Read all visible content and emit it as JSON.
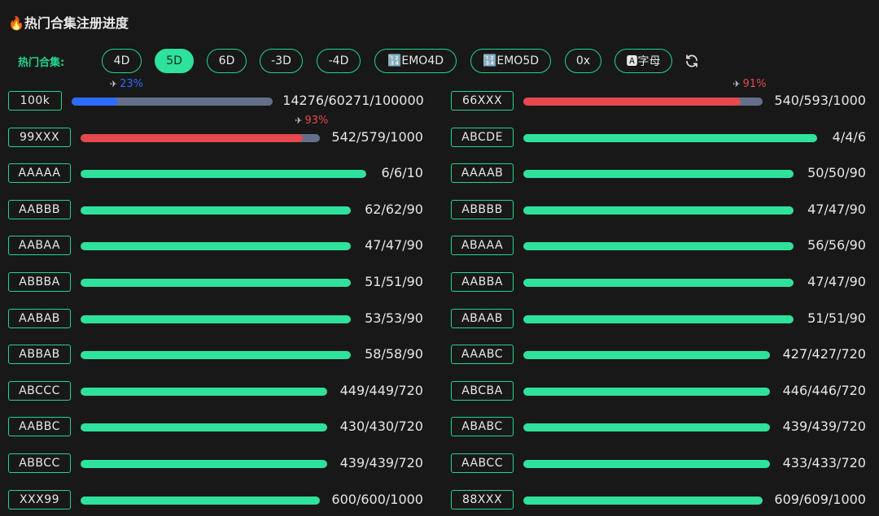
{
  "title": "🔥热门合集注册进度",
  "filter": {
    "label": "热门合集:",
    "chips": [
      {
        "label": "4D",
        "active": false
      },
      {
        "label": "5D",
        "active": true
      },
      {
        "label": "6D",
        "active": false
      },
      {
        "label": "-3D",
        "active": false
      },
      {
        "label": "-4D",
        "active": false
      },
      {
        "label": "🔢EMO4D",
        "active": false
      },
      {
        "label": "🔢EMO5D",
        "active": false
      },
      {
        "label": "0x",
        "active": false
      },
      {
        "label": "🅰字母",
        "active": false
      }
    ],
    "refresh_icon": "refresh-icon"
  },
  "colors": {
    "accent": "#23d58e",
    "fill_green": "#2ee29c",
    "fill_blue": "#2f6bff",
    "fill_red": "#e5484d",
    "track": "#63708a"
  },
  "collections": {
    "left": [
      {
        "tag": "100k",
        "value": "14276/60271/100000",
        "progress": 0.23,
        "percent_label": "23%",
        "color": "blue",
        "plane_icon": "✈"
      },
      {
        "tag": "99XXX",
        "value": "542/579/1000",
        "progress": 0.93,
        "percent_label": "93%",
        "color": "red",
        "plane_icon": "✈"
      },
      {
        "tag": "AAAAA",
        "value": "6/6/10",
        "progress": 1,
        "color": "green"
      },
      {
        "tag": "AABBB",
        "value": "62/62/90",
        "progress": 1,
        "color": "green"
      },
      {
        "tag": "AABAA",
        "value": "47/47/90",
        "progress": 1,
        "color": "green"
      },
      {
        "tag": "ABBBA",
        "value": "51/51/90",
        "progress": 1,
        "color": "green"
      },
      {
        "tag": "AABAB",
        "value": "53/53/90",
        "progress": 1,
        "color": "green"
      },
      {
        "tag": "ABBAB",
        "value": "58/58/90",
        "progress": 1,
        "color": "green"
      },
      {
        "tag": "ABCCC",
        "value": "449/449/720",
        "progress": 1,
        "color": "green"
      },
      {
        "tag": "AABBC",
        "value": "430/430/720",
        "progress": 1,
        "color": "green"
      },
      {
        "tag": "ABBCC",
        "value": "439/439/720",
        "progress": 1,
        "color": "green"
      },
      {
        "tag": "XXX99",
        "value": "600/600/1000",
        "progress": 1,
        "color": "green"
      }
    ],
    "right": [
      {
        "tag": "66XXX",
        "value": "540/593/1000",
        "progress": 0.91,
        "percent_label": "91%",
        "color": "red",
        "plane_icon": "✈"
      },
      {
        "tag": "ABCDE",
        "value": "4/4/6",
        "progress": 1,
        "color": "green"
      },
      {
        "tag": "AAAAB",
        "value": "50/50/90",
        "progress": 1,
        "color": "green"
      },
      {
        "tag": "ABBBB",
        "value": "47/47/90",
        "progress": 1,
        "color": "green"
      },
      {
        "tag": "ABAAA",
        "value": "56/56/90",
        "progress": 1,
        "color": "green"
      },
      {
        "tag": "AABBA",
        "value": "47/47/90",
        "progress": 1,
        "color": "green"
      },
      {
        "tag": "ABAAB",
        "value": "51/51/90",
        "progress": 1,
        "color": "green"
      },
      {
        "tag": "AAABC",
        "value": "427/427/720",
        "progress": 1,
        "color": "green"
      },
      {
        "tag": "ABCBA",
        "value": "446/446/720",
        "progress": 1,
        "color": "green"
      },
      {
        "tag": "ABABC",
        "value": "439/439/720",
        "progress": 1,
        "color": "green"
      },
      {
        "tag": "AABCC",
        "value": "433/433/720",
        "progress": 1,
        "color": "green"
      },
      {
        "tag": "88XXX",
        "value": "609/609/1000",
        "progress": 1,
        "color": "green"
      }
    ]
  }
}
